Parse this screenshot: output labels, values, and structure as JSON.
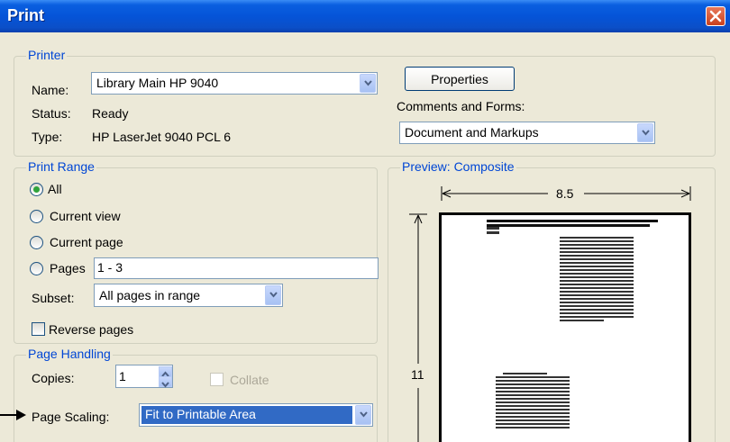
{
  "window": {
    "title": "Print"
  },
  "printer": {
    "legend": "Printer",
    "name_label": "Name:",
    "name_value": "Library Main HP 9040",
    "status_label": "Status:",
    "status_value": "Ready",
    "type_label": "Type:",
    "type_value": "HP LaserJet 9040 PCL 6",
    "properties_button": "Properties",
    "comments_label": "Comments and Forms:",
    "comments_value": "Document and Markups"
  },
  "print_range": {
    "legend": "Print Range",
    "all": "All",
    "current_view": "Current view",
    "current_page": "Current page",
    "pages": "Pages",
    "pages_value": "1 - 3",
    "selected": "All",
    "subset_label": "Subset:",
    "subset_value": "All pages in range",
    "reverse_pages": "Reverse pages",
    "reverse_checked": false
  },
  "page_handling": {
    "legend": "Page Handling",
    "copies_label": "Copies:",
    "copies_value": "1",
    "collate": "Collate",
    "collate_enabled": false,
    "scaling_label": "Page Scaling:",
    "scaling_value": "Fit to Printable Area"
  },
  "preview": {
    "legend": "Preview: Composite",
    "width": "8.5",
    "height": "11"
  },
  "colors": {
    "title_bar": "#0554d8",
    "legend_text": "#0046d5",
    "dialog_bg": "#ece9d8",
    "selection": "#316ac5"
  }
}
